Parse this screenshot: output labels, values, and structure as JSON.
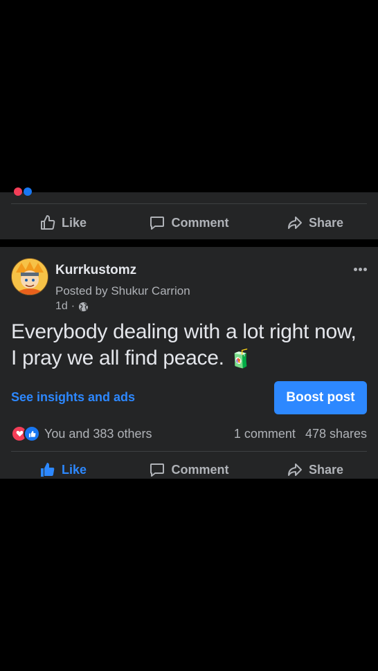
{
  "prev_post": {
    "actions": {
      "like": "Like",
      "comment": "Comment",
      "share": "Share"
    }
  },
  "post": {
    "author": "Kurrkustomz",
    "posted_by": "Posted by Shukur Carrion",
    "time": "1d",
    "meta_separator": "·",
    "text": "Everybody dealing with a lot right now, I pray we all find peace.",
    "emoji": "🧃",
    "insights_link": "See insights and ads",
    "boost_label": "Boost post",
    "reactions_summary": "You and 383 others",
    "comments_count": "1 comment",
    "shares_count": "478 shares",
    "actions": {
      "like": "Like",
      "comment": "Comment",
      "share": "Share"
    }
  },
  "colors": {
    "accent": "#2d88ff",
    "card": "#242526",
    "muted": "#b0b3b8",
    "text": "#e4e6eb"
  },
  "icons": [
    "thumbs-up-icon",
    "comment-icon",
    "share-icon",
    "globe-icon",
    "more-icon",
    "heart-reaction-icon",
    "like-reaction-icon"
  ]
}
